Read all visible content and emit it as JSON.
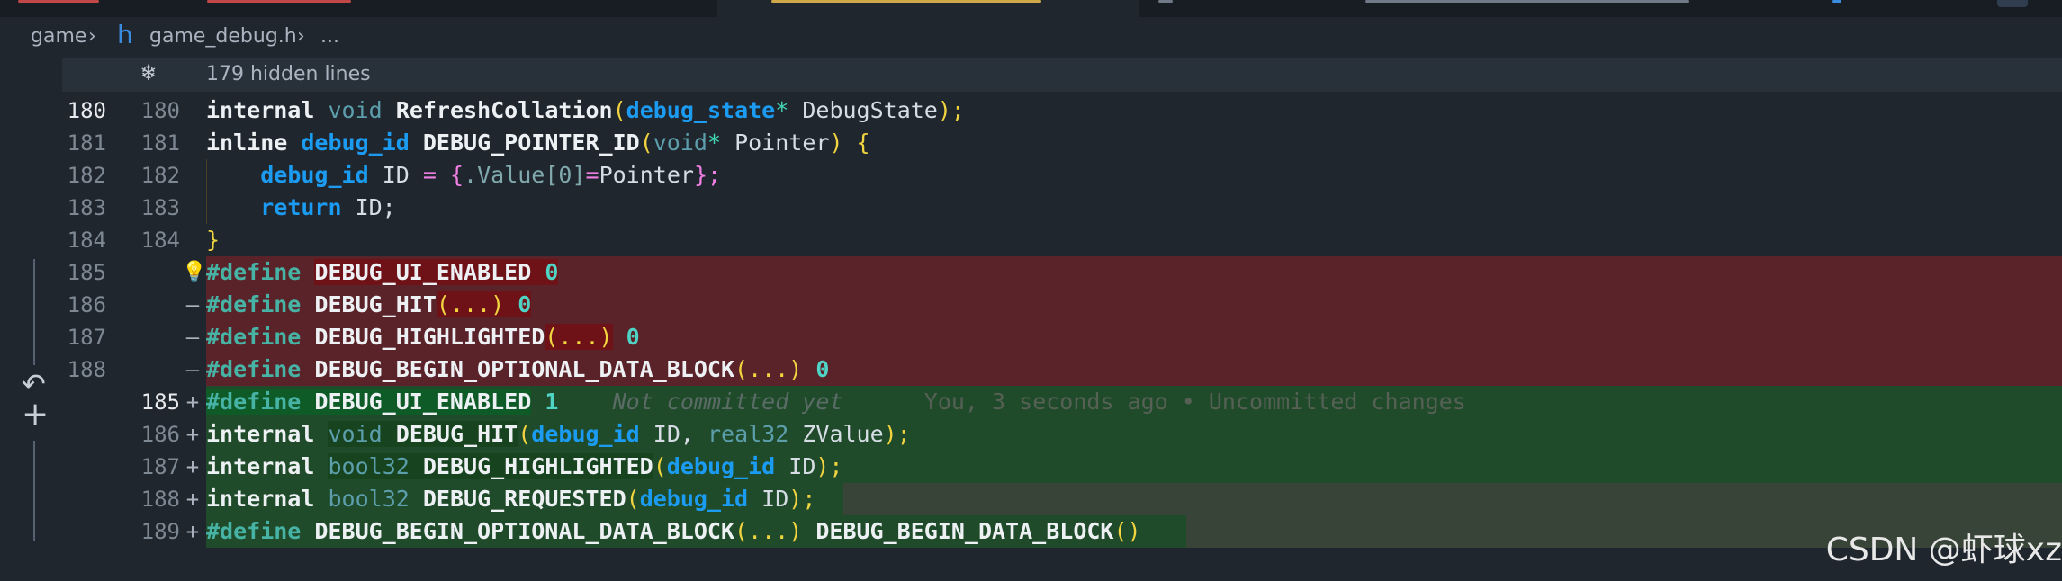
{
  "breadcrumb": {
    "folder": "game",
    "file_icon": "h",
    "file": "game_debug.h",
    "more": "..."
  },
  "fold": {
    "icon": "fold-snowflake-icon",
    "text": "179 hidden lines"
  },
  "lines": [
    {
      "old": "180",
      "new": "180",
      "marker": "",
      "type": "normal"
    },
    {
      "old": "181",
      "new": "181",
      "marker": "",
      "type": "normal"
    },
    {
      "old": "182",
      "new": "182",
      "marker": "",
      "type": "normal"
    },
    {
      "old": "183",
      "new": "183",
      "marker": "",
      "type": "normal"
    },
    {
      "old": "184",
      "new": "184",
      "marker": "",
      "type": "normal"
    },
    {
      "old": "185",
      "new": "",
      "marker": "",
      "type": "del"
    },
    {
      "old": "186",
      "new": "",
      "marker": "—",
      "type": "del"
    },
    {
      "old": "187",
      "new": "",
      "marker": "—",
      "type": "del"
    },
    {
      "old": "188",
      "new": "",
      "marker": "—",
      "type": "del"
    },
    {
      "old": "",
      "new": "185",
      "marker": "+",
      "type": "add"
    },
    {
      "old": "",
      "new": "186",
      "marker": "+",
      "type": "add"
    },
    {
      "old": "",
      "new": "187",
      "marker": "+",
      "type": "add"
    },
    {
      "old": "",
      "new": "188",
      "marker": "+",
      "type": "add"
    },
    {
      "old": "",
      "new": "189",
      "marker": "+",
      "type": "add"
    }
  ],
  "code": {
    "l180": {
      "a": "internal",
      "b": "void",
      "c": "RefreshCollation",
      "d": "(",
      "e": "debug_state",
      "f": "*",
      "g": " DebugState",
      "h": ");"
    },
    "l181": {
      "a": "inline",
      "b": "debug_id",
      "c": "DEBUG_POINTER_ID",
      "d": "(",
      "e": "void",
      "f": "*",
      "g": " Pointer",
      "h": ") {"
    },
    "l182": {
      "a": "debug_id",
      "b": " ID ",
      "c": "=",
      "d": "{",
      "e": ".Value[0]",
      "f": "=",
      "g": "Pointer",
      "h": "};"
    },
    "l183": {
      "a": "return",
      "b": " ID;"
    },
    "l184": {
      "a": "}"
    },
    "d185": {
      "a": "#define",
      "b": "DEBUG_UI_ENABLED",
      "c": "0"
    },
    "d186": {
      "a": "#define",
      "b": "DEBUG_HIT",
      "c": "(...)",
      "d": "0"
    },
    "d187": {
      "a": "#define",
      "b": "DEBUG_HIGHLIGHTED",
      "c": "(...)",
      "d": "0"
    },
    "d188": {
      "a": "#define",
      "b": "DEBUG_BEGIN_OPTIONAL_DATA_BLOCK",
      "c": "(...)",
      "d": "0"
    },
    "a185": {
      "a": "#define",
      "b": "DEBUG_UI_ENABLED",
      "c": "1",
      "blame1": "Not committed yet",
      "blame2": "You, 3 seconds ago • Uncommitted changes"
    },
    "a186": {
      "a": "internal",
      "b": "void",
      "c": "DEBUG_HIT",
      "d": "(",
      "e": "debug_id",
      "f": " ID, ",
      "g": "real32",
      "h": " ZValue",
      "i": ");"
    },
    "a187": {
      "a": "internal",
      "b": "bool32",
      "c": "DEBUG_HIGHLIGHTED",
      "d": "(",
      "e": "debug_id",
      "f": " ID",
      "g": ");"
    },
    "a188": {
      "a": "internal",
      "b": "bool32",
      "c": "DEBUG_REQUESTED",
      "d": "(",
      "e": "debug_id",
      "f": " ID",
      "g": ");"
    },
    "a189": {
      "a": "#define",
      "b": "DEBUG_BEGIN_OPTIONAL_DATA_BLOCK",
      "c": "(...)",
      "d": "DEBUG_BEGIN_DATA_BLOCK",
      "e": "()"
    }
  },
  "gutter": {
    "lightbulb": "lightbulb-icon",
    "revert": "↶",
    "stage": "+"
  },
  "watermark": "CSDN @虾球xz",
  "colors": {
    "deleted_bg": "#5a2229",
    "added_bg": "#1f4b2a",
    "editor_bg": "#1f262e"
  }
}
